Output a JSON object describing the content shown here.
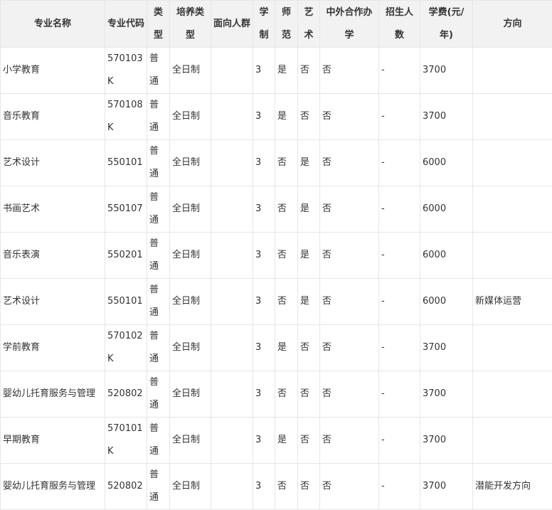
{
  "table": {
    "headers": [
      "专业名称",
      "专业代码",
      "类型",
      "培养类型",
      "面向人群",
      "学制",
      "师范",
      "艺术",
      "中外合作办学",
      "招生人数",
      "学费(元/年)",
      "方向"
    ],
    "rows": [
      [
        "小学教育",
        "570103K",
        "普通",
        "全日制",
        "",
        "3",
        "是",
        "否",
        "否",
        "-",
        "3700",
        ""
      ],
      [
        "音乐教育",
        "570108K",
        "普通",
        "全日制",
        "",
        "3",
        "是",
        "否",
        "否",
        "-",
        "3700",
        ""
      ],
      [
        "艺术设计",
        "550101",
        "普通",
        "全日制",
        "",
        "3",
        "否",
        "是",
        "否",
        "-",
        "6000",
        ""
      ],
      [
        "书画艺术",
        "550107",
        "普通",
        "全日制",
        "",
        "3",
        "否",
        "是",
        "否",
        "-",
        "6000",
        ""
      ],
      [
        "音乐表演",
        "550201",
        "普通",
        "全日制",
        "",
        "3",
        "否",
        "是",
        "否",
        "-",
        "6000",
        ""
      ],
      [
        "艺术设计",
        "550101",
        "普通",
        "全日制",
        "",
        "3",
        "否",
        "是",
        "否",
        "-",
        "6000",
        "新媒体运营"
      ],
      [
        "学前教育",
        "570102K",
        "普通",
        "全日制",
        "",
        "3",
        "是",
        "否",
        "否",
        "-",
        "3700",
        ""
      ],
      [
        "婴幼儿托育服务与管理",
        "520802",
        "普通",
        "全日制",
        "",
        "3",
        "否",
        "否",
        "否",
        "-",
        "3700",
        ""
      ],
      [
        "早期教育",
        "570101K",
        "普通",
        "全日制",
        "",
        "3",
        "是",
        "否",
        "否",
        "-",
        "3700",
        ""
      ],
      [
        "婴幼儿托育服务与管理",
        "520802",
        "普通",
        "全日制",
        "",
        "3",
        "否",
        "否",
        "否",
        "-",
        "3700",
        "潜能开发方向"
      ]
    ]
  }
}
